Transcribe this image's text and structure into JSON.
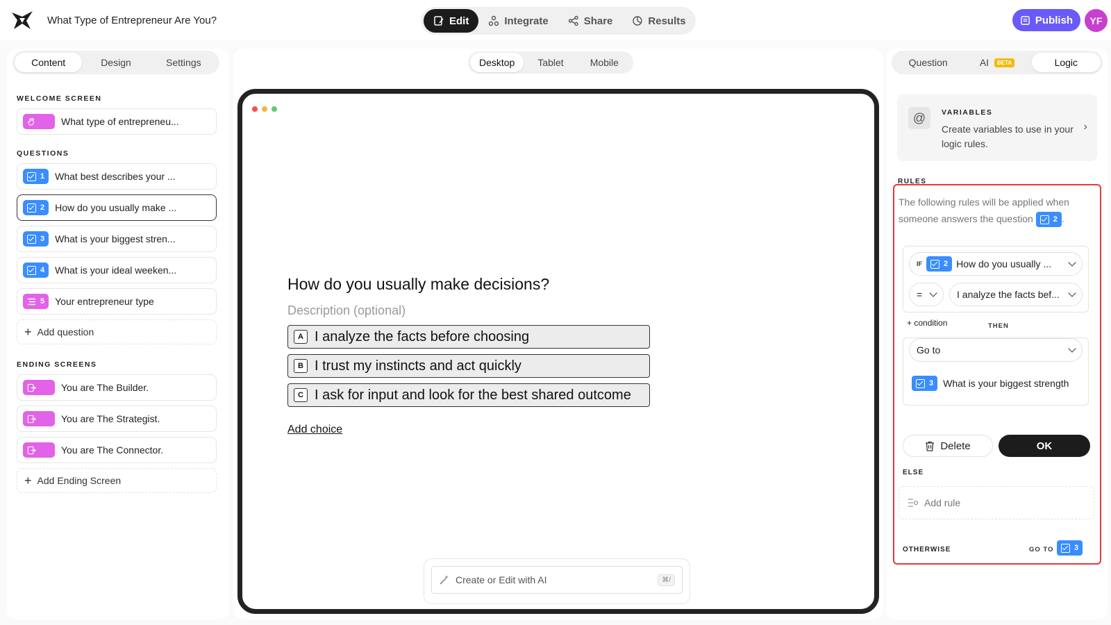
{
  "header": {
    "form_title": "What Type of Entrepreneur Are You?",
    "tabs": [
      {
        "label": "Edit",
        "icon": "edit-icon",
        "active": true
      },
      {
        "label": "Integrate",
        "icon": "integrate-icon",
        "active": false
      },
      {
        "label": "Share",
        "icon": "share-icon",
        "active": false
      },
      {
        "label": "Results",
        "icon": "results-icon",
        "active": false
      }
    ],
    "publish_label": "Publish",
    "avatar_initials": "YF"
  },
  "left": {
    "tabs": [
      "Content",
      "Design",
      "Settings"
    ],
    "welcome_label": "WELCOME SCREEN",
    "welcome_item": "What type of entrepreneu...",
    "questions_label": "QUESTIONS",
    "questions": [
      {
        "num": "1",
        "text": "What best describes your ..."
      },
      {
        "num": "2",
        "text": "How do you usually make ..."
      },
      {
        "num": "3",
        "text": "What is your biggest stren..."
      },
      {
        "num": "4",
        "text": "What is your ideal weeken..."
      },
      {
        "num": "5",
        "text": "Your entrepreneur type"
      }
    ],
    "add_question": "Add question",
    "endings_label": "ENDING SCREENS",
    "endings": [
      "You are The Builder.",
      "You are The Strategist.",
      "You are The Connector."
    ],
    "add_ending": "Add Ending Screen"
  },
  "center": {
    "device_tabs": [
      "Desktop",
      "Tablet",
      "Mobile"
    ],
    "question_title": "How do you usually make decisions?",
    "description_placeholder": "Description (optional)",
    "choices": [
      {
        "key": "A",
        "text": "I analyze the facts before choosing"
      },
      {
        "key": "B",
        "text": "I trust my instincts and act quickly"
      },
      {
        "key": "C",
        "text": "I ask for input and look for the best shared outcome"
      }
    ],
    "add_choice": "Add choice",
    "ai_placeholder": "Create or Edit with AI",
    "ai_shortcut": "⌘/"
  },
  "right": {
    "tabs": [
      "Question",
      "AI",
      "Logic"
    ],
    "ai_badge": "BETA",
    "variables_title": "VARIABLES",
    "variables_desc": "Create variables to use in your logic rules.",
    "rules_label": "RULES",
    "rules_intro": "The following rules will be applied when someone answers the question",
    "rules_intro_end": ".",
    "question_num": "2",
    "if_label": "IF",
    "if_question": "How do you usually ...",
    "operator": "=",
    "answer": "I analyze the facts bef...",
    "add_condition": "+ condition",
    "then_label": "THEN",
    "action": "Go to",
    "target_num": "3",
    "target_text": "What is your biggest strength",
    "delete_label": "Delete",
    "ok_label": "OK",
    "else_label": "ELSE",
    "add_rule": "Add rule",
    "otherwise_label": "OTHERWISE",
    "goto_label": "GO TO",
    "otherwise_num": "3"
  },
  "colors": {
    "accent": "#6a5af9",
    "blue": "#3a8dff",
    "pink": "#e262e8",
    "highlight": "#e53935"
  }
}
